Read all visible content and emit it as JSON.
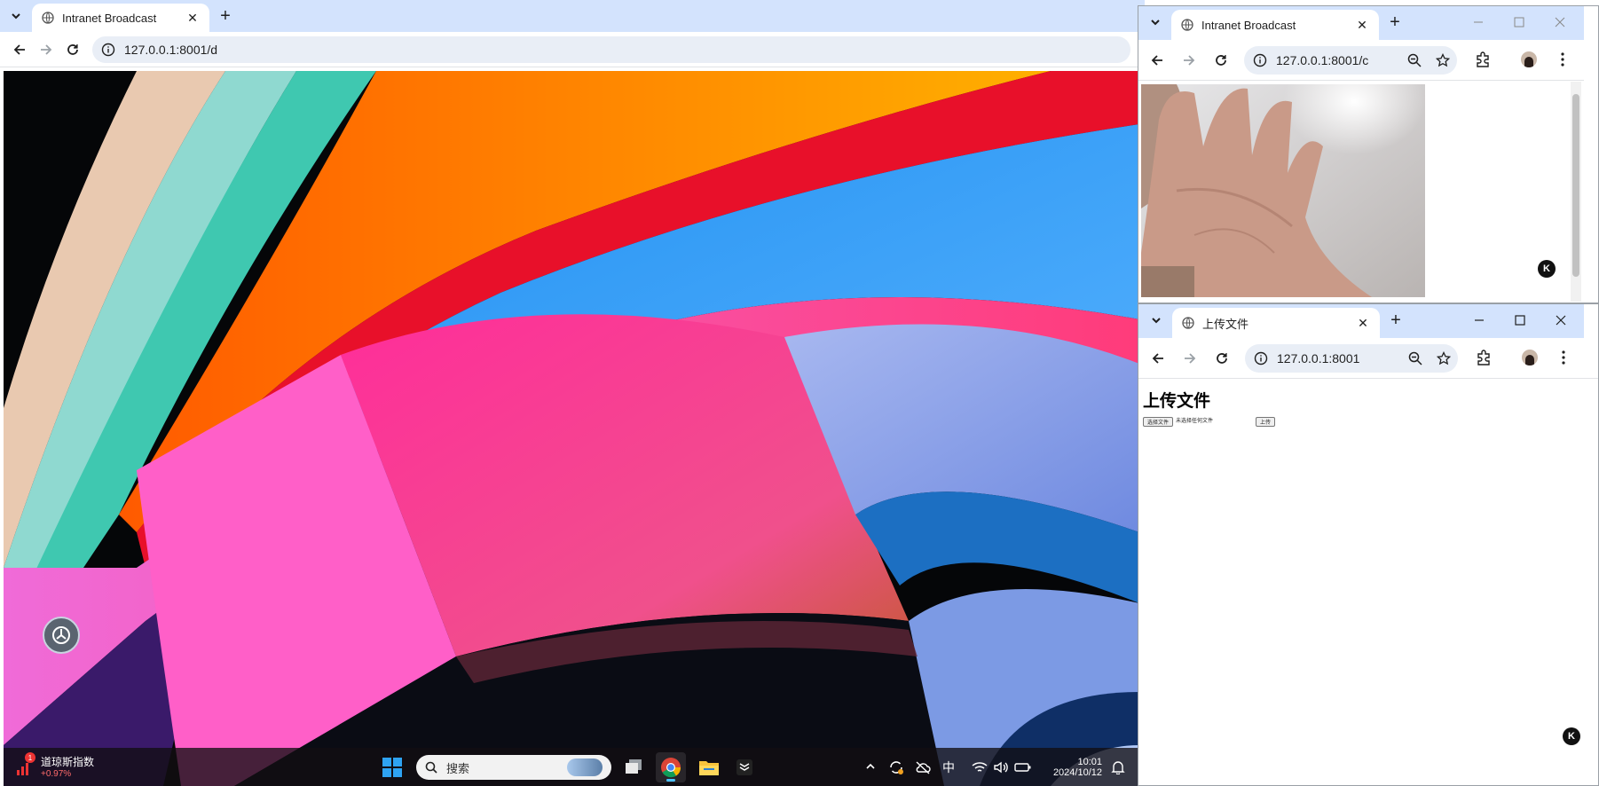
{
  "main_window": {
    "tab_title": "Intranet Broadcast",
    "url": "127.0.0.1:8001/d"
  },
  "popup_top": {
    "tab_title": "Intranet Broadcast",
    "url": "127.0.0.1:8001/c",
    "badge_letter": "K"
  },
  "popup_bottom": {
    "tab_title": "上传文件",
    "url": "127.0.0.1:8001",
    "heading": "上传文件",
    "choose_file_label": "选择文件",
    "file_status": "未选择任何文件",
    "upload_label": "上传",
    "badge_letter": "K"
  },
  "taskbar": {
    "widget_badge": "1",
    "widget_title": "道琼斯指数",
    "widget_change": "+0.97%",
    "search_placeholder": "搜索",
    "ime_label": "中",
    "time": "10:01",
    "date": "2024/10/12"
  },
  "colors": {
    "tabstrip": "#d3e3fd",
    "omnibox": "#e9eef6",
    "widget_change": "#ff6b6b"
  },
  "icons": [
    "tab-search-icon",
    "globe-icon",
    "close-icon",
    "plus-icon",
    "back-icon",
    "forward-icon",
    "reload-icon",
    "info-icon",
    "zoom-icon",
    "star-icon",
    "extensions-icon",
    "avatar",
    "more-icon",
    "minimize-icon",
    "maximize-icon",
    "windows-start-icon",
    "search-icon",
    "task-view-icon",
    "chrome-icon",
    "file-explorer-icon",
    "app-icon",
    "chevron-up-icon",
    "sync-icon",
    "cloud-off-icon",
    "wifi-icon",
    "volume-icon",
    "battery-icon",
    "bell-icon"
  ]
}
